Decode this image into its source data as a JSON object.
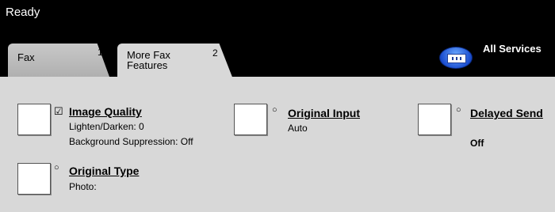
{
  "status": {
    "text": "Ready"
  },
  "tabs": [
    {
      "label": "Fax",
      "number": "1"
    },
    {
      "label": "More Fax\nFeatures",
      "number": "2"
    }
  ],
  "all_services": {
    "label": "All Services",
    "icon": "all-services-icon"
  },
  "features": {
    "image_quality": {
      "title": "Image Quality",
      "indicator": "☑",
      "lines": [
        "Lighten/Darken: 0",
        "Background Suppression: Off"
      ]
    },
    "original_input": {
      "title": "Original Input",
      "indicator": "○",
      "value": "Auto"
    },
    "delayed_send": {
      "title": "Delayed Send",
      "indicator": "○",
      "value": "Off"
    },
    "original_type": {
      "title": "Original Type",
      "indicator": "○",
      "value": "Photo:"
    }
  }
}
